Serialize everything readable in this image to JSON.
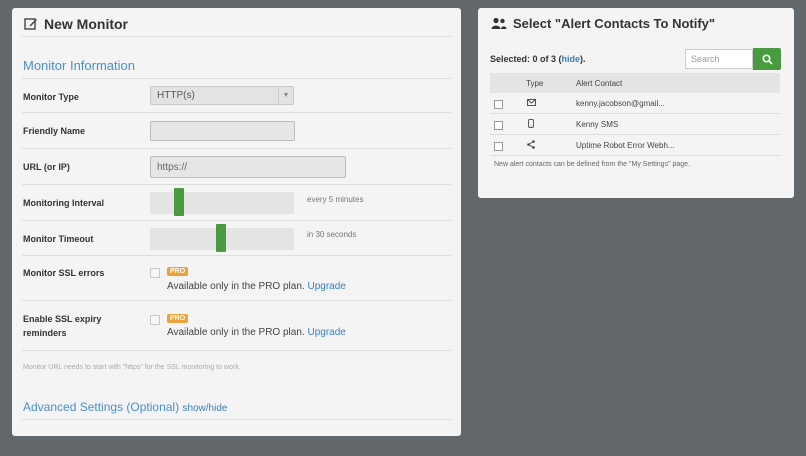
{
  "left_panel": {
    "title": "New Monitor",
    "section_title": "Monitor Information",
    "monitor_type": {
      "label": "Monitor Type",
      "value": "HTTP(s)"
    },
    "friendly_name": {
      "label": "Friendly Name",
      "value": ""
    },
    "url": {
      "label": "URL (or IP)",
      "value": "https://"
    },
    "monitoring_interval": {
      "label": "Monitoring Interval",
      "note": "every 5 minutes"
    },
    "monitor_timeout": {
      "label": "Monitor Timeout",
      "note": "in 30 seconds"
    },
    "ssl_errors": {
      "label": "Monitor SSL errors",
      "badge": "PRO",
      "availability": "Available only in the PRO plan.",
      "upgrade": "Upgrade"
    },
    "ssl_expiry": {
      "label_line1": "Enable SSL expiry",
      "label_line2": "reminders",
      "badge": "PRO",
      "availability": "Available only in the PRO plan.",
      "upgrade": "Upgrade"
    },
    "ssl_note": "Monitor URL needs to start with \"https\" for the SSL monitoring to work.",
    "advanced": {
      "title": "Advanced Settings (Optional)",
      "toggle": "show/hide"
    }
  },
  "right_panel": {
    "title": "Select \"Alert Contacts To Notify\"",
    "selected_prefix": "Selected: 0 of 3 (",
    "hide_link": "hide",
    "selected_suffix": ").",
    "search_placeholder": "Search",
    "columns": {
      "type": "Type",
      "contact": "Alert Contact"
    },
    "contacts": [
      {
        "icon": "email-icon",
        "name": "kenny.jacobson@gmail..."
      },
      {
        "icon": "mobile-icon",
        "name": "Kenny SMS"
      },
      {
        "icon": "share-icon",
        "name": "Uptime Robot Error Webh..."
      }
    ],
    "footer_note": "New alert contacts can be defined from the \"My Settings\" page."
  },
  "colors": {
    "accent_blue": "#4a8fd0",
    "green": "#4a9a3f",
    "pro_orange": "#e8a33d",
    "background": "#62676b"
  }
}
